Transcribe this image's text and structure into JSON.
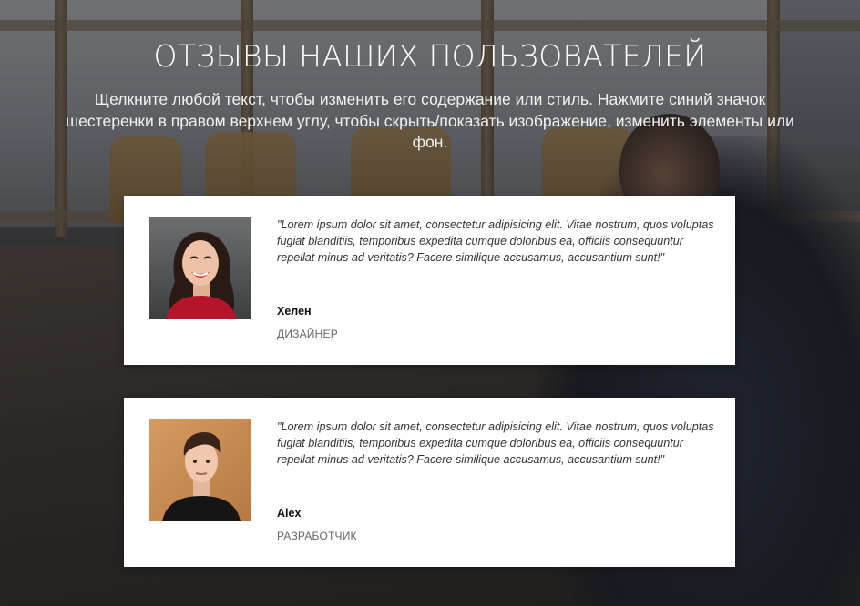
{
  "section": {
    "title": "ОТЗЫВЫ НАШИХ ПОЛЬЗОВАТЕЛЕЙ",
    "subtitle": "Щелкните любой текст, чтобы изменить его содержание или стиль. Нажмите синий значок шестеренки в правом верхнем углу, чтобы скрыть/показать изображение, изменить элементы или фон."
  },
  "testimonials": [
    {
      "quote": "\"Lorem ipsum dolor sit amet, consectetur adipisicing elit. Vitae nostrum, quos voluptas fugiat blanditiis, temporibus expedita cumque doloribus ea, officiis consequuntur repellat minus ad veritatis? Facere similique accusamus, accusantium sunt!\"",
      "name": "Хелен",
      "role": "ДИЗАЙНЕР"
    },
    {
      "quote": "\"Lorem ipsum dolor sit amet, consectetur adipisicing elit. Vitae nostrum, quos voluptas fugiat blanditiis, temporibus expedita cumque doloribus ea, officiis consequuntur repellat minus ad veritatis? Facere similique accusamus, accusantium sunt!\"",
      "name": "Alex",
      "role": "РАЗРАБОТЧИК"
    }
  ],
  "colors": {
    "card_background": "#ffffff",
    "title_text": "#ffffff",
    "role_text": "#666666"
  }
}
